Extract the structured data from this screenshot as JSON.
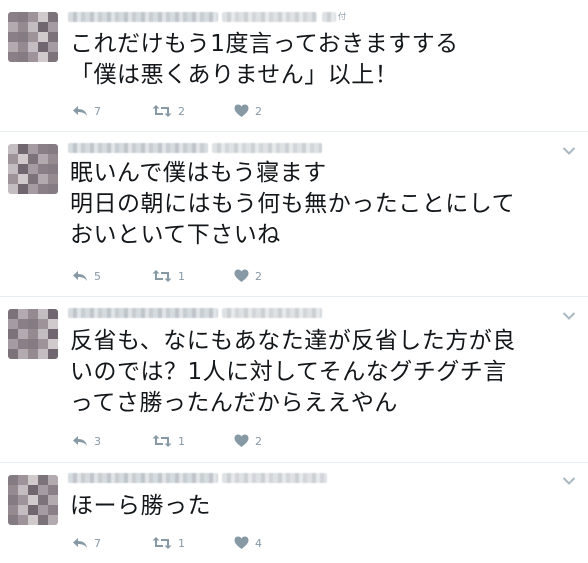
{
  "tweets": [
    {
      "lines": [
        "これだけもう1度言っておきますする",
        "「僕は悪くありません」以上！"
      ],
      "replies": "7",
      "retweets": "2",
      "likes": "2",
      "header_mark": "付"
    },
    {
      "lines": [
        "眠いんで僕はもう寝ます",
        "明日の朝にはもう何も無かったことにして",
        "おいといて下さいね"
      ],
      "replies": "5",
      "retweets": "1",
      "likes": "2"
    },
    {
      "lines": [
        "反省も、なにもあなた達が反省した方が良",
        "いのでは？1人に対してそんなグチグチ言",
        "ってさ勝ったんだからええやん"
      ],
      "replies": "3",
      "retweets": "1",
      "likes": "2"
    },
    {
      "lines": [
        "ほーら勝った"
      ],
      "replies": "7",
      "retweets": "1",
      "likes": "4"
    }
  ],
  "colors": {
    "icon_gray": "#8899a6",
    "text": "#14171a",
    "divider": "#e6ecf0"
  },
  "icons": [
    "reply-icon",
    "retweet-icon",
    "like-icon",
    "chevron-down-icon"
  ]
}
